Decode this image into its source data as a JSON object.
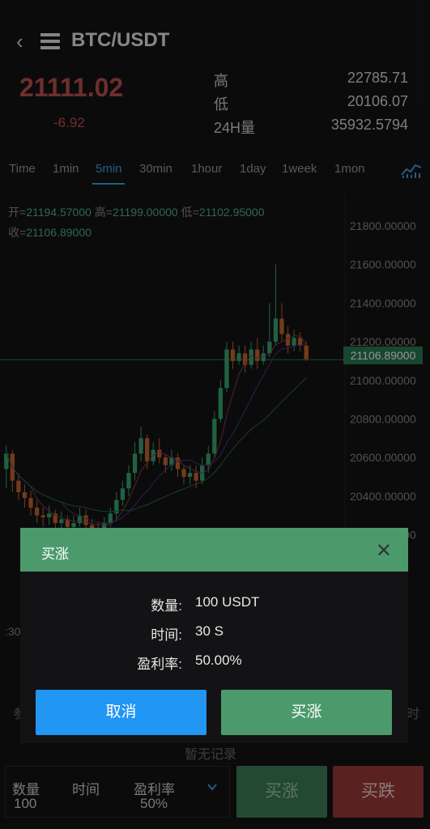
{
  "header": {
    "back_icon": "chevron-left-icon",
    "menu_icon": "list-icon",
    "pair": "BTC/USDT",
    "price": "21111.02",
    "change": "-6.92",
    "stats": [
      {
        "label": "高",
        "value": "22785.71"
      },
      {
        "label": "低",
        "value": "20106.07"
      },
      {
        "label": "24H量",
        "value": "35932.5794"
      }
    ]
  },
  "timeframes": [
    "Time",
    "1min",
    "5min",
    "30min",
    "1hour",
    "1day",
    "1week",
    "1mon"
  ],
  "active_timeframe": "5min",
  "ohlc": {
    "open_label": "开=",
    "open": "21194.57000",
    "high_label": "高=",
    "high": "21199.00000",
    "low_label": "低=",
    "low": "21102.95000",
    "close_label": "收=",
    "close": "21106.89000"
  },
  "chart_data": {
    "type": "candlestick",
    "y_ticks": [
      "21800.00000",
      "21600.00000",
      "21400.00000",
      "21200.00000",
      "21000.00000",
      "20800.00000",
      "20600.00000",
      "20400.00000",
      "20200.00000"
    ],
    "last_price": "21106.89000",
    "x_visible_label": ":30",
    "ylim": [
      20160,
      21880
    ],
    "candles": [
      [
        20540,
        20620,
        20440,
        20660
      ],
      [
        20620,
        20480,
        20420,
        20640
      ],
      [
        20480,
        20420,
        20380,
        20520
      ],
      [
        20420,
        20390,
        20340,
        20460
      ],
      [
        20390,
        20340,
        20300,
        20430
      ],
      [
        20340,
        20300,
        20260,
        20380
      ],
      [
        20300,
        20290,
        20240,
        20340
      ],
      [
        20290,
        20310,
        20250,
        20350
      ],
      [
        20310,
        20260,
        20220,
        20330
      ],
      [
        20260,
        20280,
        20230,
        20320
      ],
      [
        20280,
        20240,
        20210,
        20300
      ],
      [
        20240,
        20260,
        20200,
        20300
      ],
      [
        20260,
        20300,
        20240,
        20340
      ],
      [
        20300,
        20250,
        20220,
        20330
      ],
      [
        20250,
        20230,
        20200,
        20280
      ],
      [
        20230,
        20220,
        20180,
        20260
      ],
      [
        20220,
        20260,
        20200,
        20290
      ],
      [
        20260,
        20310,
        20240,
        20340
      ],
      [
        20310,
        20380,
        20280,
        20420
      ],
      [
        20380,
        20440,
        20350,
        20480
      ],
      [
        20440,
        20520,
        20400,
        20560
      ],
      [
        20520,
        20620,
        20480,
        20680
      ],
      [
        20620,
        20700,
        20580,
        20760
      ],
      [
        20700,
        20580,
        20540,
        20720
      ],
      [
        20580,
        20640,
        20560,
        20680
      ],
      [
        20640,
        20600,
        20570,
        20700
      ],
      [
        20600,
        20560,
        20520,
        20620
      ],
      [
        20560,
        20600,
        20530,
        20640
      ],
      [
        20600,
        20540,
        20500,
        20620
      ],
      [
        20540,
        20500,
        20460,
        20560
      ],
      [
        20500,
        20520,
        20460,
        20560
      ],
      [
        20520,
        20480,
        20440,
        20560
      ],
      [
        20480,
        20560,
        20460,
        20600
      ],
      [
        20560,
        20620,
        20520,
        20660
      ],
      [
        20620,
        20800,
        20600,
        20840
      ],
      [
        20800,
        20960,
        20780,
        21000
      ],
      [
        20960,
        21160,
        20940,
        21200
      ],
      [
        21160,
        21100,
        21060,
        21200
      ],
      [
        21100,
        21140,
        21080,
        21180
      ],
      [
        21140,
        21080,
        21040,
        21180
      ],
      [
        21080,
        21160,
        21060,
        21200
      ],
      [
        21160,
        21100,
        21060,
        21220
      ],
      [
        21100,
        21140,
        21080,
        21180
      ],
      [
        21140,
        21200,
        21120,
        21400
      ],
      [
        21200,
        21320,
        21180,
        21600
      ],
      [
        21320,
        21240,
        21200,
        21400
      ],
      [
        21240,
        21180,
        21140,
        21280
      ],
      [
        21180,
        21220,
        21150,
        21260
      ],
      [
        21220,
        21180,
        21150,
        21250
      ],
      [
        21180,
        21110,
        21100,
        21200
      ]
    ]
  },
  "modal": {
    "title": "买涨",
    "close_icon": "close-icon",
    "rows": [
      {
        "label": "数量:",
        "value": "100 USDT"
      },
      {
        "label": "时间:",
        "value": "30 S"
      },
      {
        "label": "盈利率:",
        "value": "50.00%"
      }
    ],
    "cancel_label": "取消",
    "confirm_label": "买涨"
  },
  "empty_hint": "暂无记录",
  "side_left": "参",
  "side_right": "时",
  "order_bar": {
    "qty_label": "数量",
    "qty_value": "100",
    "time_label": "时间",
    "rate_label": "盈利率",
    "rate_value": "50%",
    "expand_icon": "chevron-down-icon",
    "buy_up_label": "买涨",
    "buy_down_label": "买跌"
  },
  "colors": {
    "up": "#3aa873",
    "down": "#c0504d",
    "accent": "#3aa0e8",
    "modal_header": "#4c9a6c",
    "cancel": "#2196f3"
  }
}
